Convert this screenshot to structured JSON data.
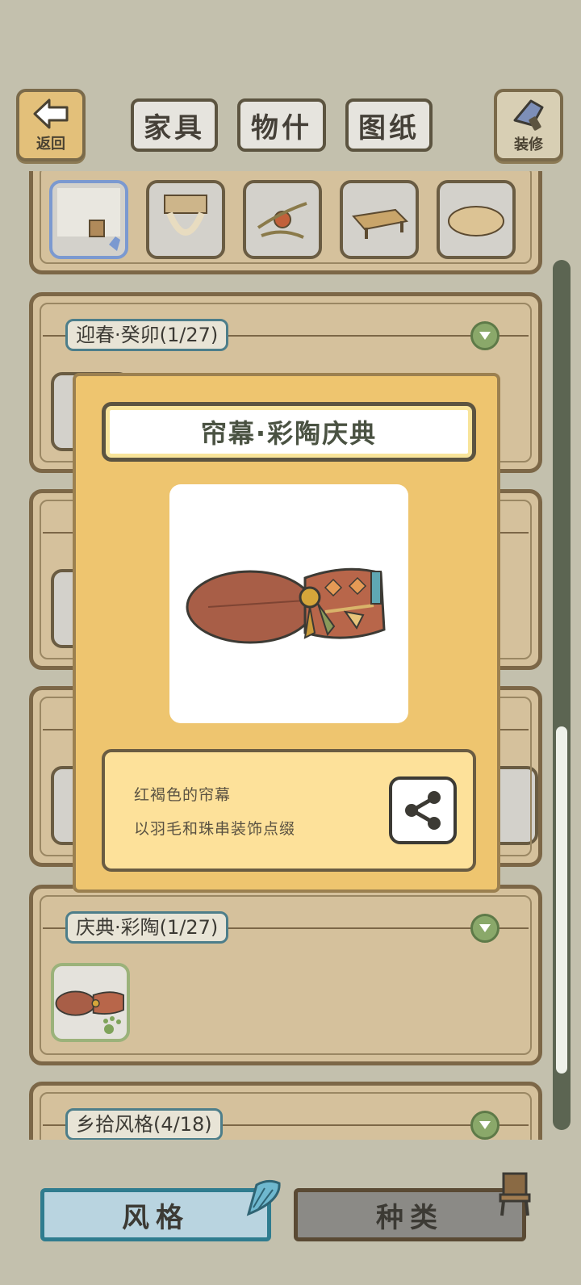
{
  "header": {
    "back_label": "返回",
    "decorate_label": "装修",
    "tabs": [
      "家具",
      "物什",
      "图纸"
    ]
  },
  "sections": [
    {
      "label": "迎春·癸卯(1/27)"
    },
    {
      "label": "庆典·彩陶(1/27)"
    },
    {
      "label": "乡拾风格(4/18)"
    }
  ],
  "modal": {
    "title": "帘幕·彩陶庆典",
    "description_line1": "红褐色的帘幕",
    "description_line2": "以羽毛和珠串装饰点缀"
  },
  "bottom": {
    "style_label": "风格",
    "kind_label": "种类"
  },
  "colors": {
    "background": "#c3c0ad",
    "panel": "#d5c19c",
    "modal": "#eec56f",
    "accent_teal": "#2f7c8f"
  },
  "icons": [
    "back-arrow-icon",
    "paint-brush-icon",
    "share-icon",
    "chevron-down-icon",
    "paw-icon",
    "shell-icon",
    "chair-icon"
  ]
}
